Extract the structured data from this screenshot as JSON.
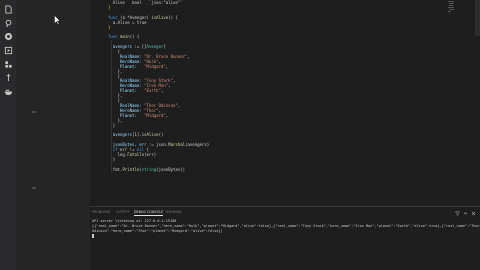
{
  "activity_bar": {
    "icons": [
      {
        "name": "files-icon"
      },
      {
        "name": "search-icon"
      },
      {
        "name": "source-control-icon"
      },
      {
        "name": "run-debug-icon"
      },
      {
        "name": "extensions-icon"
      },
      {
        "name": "timeline-icon"
      },
      {
        "name": "docker-icon"
      }
    ]
  },
  "editor": {
    "lines": [
      {
        "n": "",
        "indent": 2,
        "parts": [
          {
            "t": "Alive   bool   `json:\"alive\"`",
            "c": "pl"
          }
        ]
      },
      {
        "n": "",
        "indent": 0,
        "parts": [
          {
            "t": "}",
            "c": "br"
          }
        ]
      },
      {
        "n": "",
        "indent": 0,
        "parts": []
      },
      {
        "n": "",
        "indent": 0,
        "parts": [
          {
            "t": "func ",
            "c": "kw"
          },
          {
            "t": "(a *Avenger) ",
            "c": "pl"
          },
          {
            "t": "isAlive",
            "c": "fn"
          },
          {
            "t": "() {",
            "c": "pl"
          }
        ]
      },
      {
        "n": "",
        "indent": 2,
        "parts": [
          {
            "t": "a.Alive = true",
            "c": "pl"
          }
        ]
      },
      {
        "n": "",
        "indent": 0,
        "parts": [
          {
            "t": "}",
            "c": "br"
          }
        ]
      },
      {
        "n": "",
        "indent": 0,
        "parts": []
      },
      {
        "n": "",
        "indent": 0,
        "parts": [
          {
            "t": "func ",
            "c": "kw"
          },
          {
            "t": "main",
            "c": "fn"
          },
          {
            "t": "() {",
            "c": "pl"
          }
        ]
      },
      {
        "n": "",
        "indent": 0,
        "parts": []
      },
      {
        "n": "",
        "indent": 2,
        "parts": [
          {
            "t": "avengers ",
            "c": "id"
          },
          {
            "t": ":= []",
            "c": "pl"
          },
          {
            "t": "Avenger",
            "c": "ty"
          },
          {
            "t": "{",
            "c": "pl"
          }
        ]
      },
      {
        "n": "",
        "indent": 4,
        "parts": [
          {
            "t": "{",
            "c": "pl"
          }
        ]
      },
      {
        "n": "",
        "indent": 5,
        "parts": [
          {
            "t": "RealName: ",
            "c": "id"
          },
          {
            "t": "\"Dr. Bruce Banner\"",
            "c": "st"
          },
          {
            "t": ",",
            "c": "pl"
          }
        ]
      },
      {
        "n": "",
        "indent": 5,
        "parts": [
          {
            "t": "HeroName: ",
            "c": "id"
          },
          {
            "t": "\"Hulk\"",
            "c": "st"
          },
          {
            "t": ",",
            "c": "pl"
          }
        ]
      },
      {
        "n": "",
        "indent": 5,
        "parts": [
          {
            "t": "Planet:   ",
            "c": "id"
          },
          {
            "t": "\"Midgard\"",
            "c": "st"
          },
          {
            "t": ",",
            "c": "pl"
          }
        ]
      },
      {
        "n": "",
        "indent": 4,
        "parts": [
          {
            "t": "},",
            "c": "pl"
          }
        ]
      },
      {
        "n": "",
        "indent": 4,
        "parts": [
          {
            "t": "{",
            "c": "pl"
          }
        ]
      },
      {
        "n": "",
        "indent": 5,
        "parts": [
          {
            "t": "RealName: ",
            "c": "id"
          },
          {
            "t": "\"Tony Stark\"",
            "c": "st"
          },
          {
            "t": ",",
            "c": "pl"
          }
        ]
      },
      {
        "n": "",
        "indent": 5,
        "parts": [
          {
            "t": "HeroName: ",
            "c": "id"
          },
          {
            "t": "\"Iron Man\"",
            "c": "st"
          },
          {
            "t": ",",
            "c": "pl"
          }
        ]
      },
      {
        "n": "",
        "indent": 5,
        "parts": [
          {
            "t": "Planet:   ",
            "c": "id"
          },
          {
            "t": "\"Earth\"",
            "c": "st"
          },
          {
            "t": ",",
            "c": "pl"
          }
        ]
      },
      {
        "n": "",
        "indent": 4,
        "parts": [
          {
            "t": "},",
            "c": "pl"
          }
        ]
      },
      {
        "n": "",
        "indent": 4,
        "parts": [
          {
            "t": "{",
            "c": "pl"
          }
        ]
      },
      {
        "n": "",
        "indent": 5,
        "parts": [
          {
            "t": "RealName: ",
            "c": "id"
          },
          {
            "t": "\"Thor Odinson\"",
            "c": "st"
          },
          {
            "t": ",",
            "c": "pl"
          }
        ]
      },
      {
        "n": "",
        "indent": 5,
        "parts": [
          {
            "t": "HeroName: ",
            "c": "id"
          },
          {
            "t": "\"Thor\"",
            "c": "st"
          },
          {
            "t": ",",
            "c": "pl"
          }
        ]
      },
      {
        "n": "",
        "indent": 5,
        "parts": [
          {
            "t": "Planet:   ",
            "c": "id"
          },
          {
            "t": "\"Midgard\"",
            "c": "st"
          },
          {
            "t": ",",
            "c": "pl"
          }
        ]
      },
      {
        "n": "",
        "indent": 4,
        "parts": [
          {
            "t": "},",
            "c": "pl"
          }
        ]
      },
      {
        "n": "",
        "indent": 2,
        "parts": [
          {
            "t": "}",
            "c": "pl"
          }
        ]
      },
      {
        "n": "",
        "indent": 0,
        "parts": []
      },
      {
        "n": "",
        "indent": 2,
        "parts": [
          {
            "t": "avengers",
            "c": "id"
          },
          {
            "t": "[1].",
            "c": "pl"
          },
          {
            "t": "isAlive",
            "c": "fn"
          },
          {
            "t": "()",
            "c": "pl"
          }
        ]
      },
      {
        "n": "",
        "indent": 0,
        "parts": []
      },
      {
        "n": "",
        "indent": 2,
        "parts": [
          {
            "t": "jsonBytes, err ",
            "c": "id"
          },
          {
            "t": ":= json.",
            "c": "pl"
          },
          {
            "t": "Marshal",
            "c": "fn"
          },
          {
            "t": "(avengers)",
            "c": "pl"
          }
        ]
      },
      {
        "n": "",
        "indent": 2,
        "parts": [
          {
            "t": "if ",
            "c": "kw"
          },
          {
            "t": "err != ",
            "c": "pl"
          },
          {
            "t": "nil",
            "c": "kw"
          },
          {
            "t": " {",
            "c": "pl"
          }
        ]
      },
      {
        "n": "",
        "indent": 4,
        "parts": [
          {
            "t": "log.",
            "c": "pl"
          },
          {
            "t": "Fatalln",
            "c": "fn"
          },
          {
            "t": "(err)",
            "c": "pl"
          }
        ]
      },
      {
        "n": "",
        "indent": 2,
        "parts": [
          {
            "t": "}",
            "c": "pl"
          }
        ]
      },
      {
        "n": "",
        "indent": 0,
        "parts": []
      },
      {
        "n": "",
        "indent": 2,
        "parts": [
          {
            "t": "fmt.",
            "c": "pl"
          },
          {
            "t": "Println",
            "c": "fn"
          },
          {
            "t": "(",
            "c": "pl"
          },
          {
            "t": "string",
            "c": "ty"
          },
          {
            "t": "(jsonBytes))",
            "c": "pl"
          }
        ]
      }
    ]
  },
  "panel": {
    "tabs": [
      "PROBLEMS",
      "OUTPUT",
      "DEBUG CONSOLE",
      "TERMINAL"
    ],
    "active_tab": 2,
    "terminal_lines": [
      "API server listening at: 127.0.0.1:19180",
      "[{\"real_name\":\"Dr. Bruce Banner\",\"hero_name\":\"Hulk\",\"planet\":\"Midgard\",\"alive\":false},{\"real_name\":\"Tony Stark\",\"hero_name\":\"Iron Man\",\"planet\":\"Earth\",\"alive\":true},{\"real_name\":\"Thor",
      "Odinson\",\"hero_name\":\"Thor\",\"planet\":\"Midgard\",\"alive\":false}]"
    ]
  },
  "colors": {
    "editor_bg": "#1e1e1e",
    "sidebar_bg": "#252526",
    "activity_bg": "#2a2a2c",
    "keyword": "#569cd6",
    "string": "#ce9178",
    "function": "#dcdcaa"
  }
}
